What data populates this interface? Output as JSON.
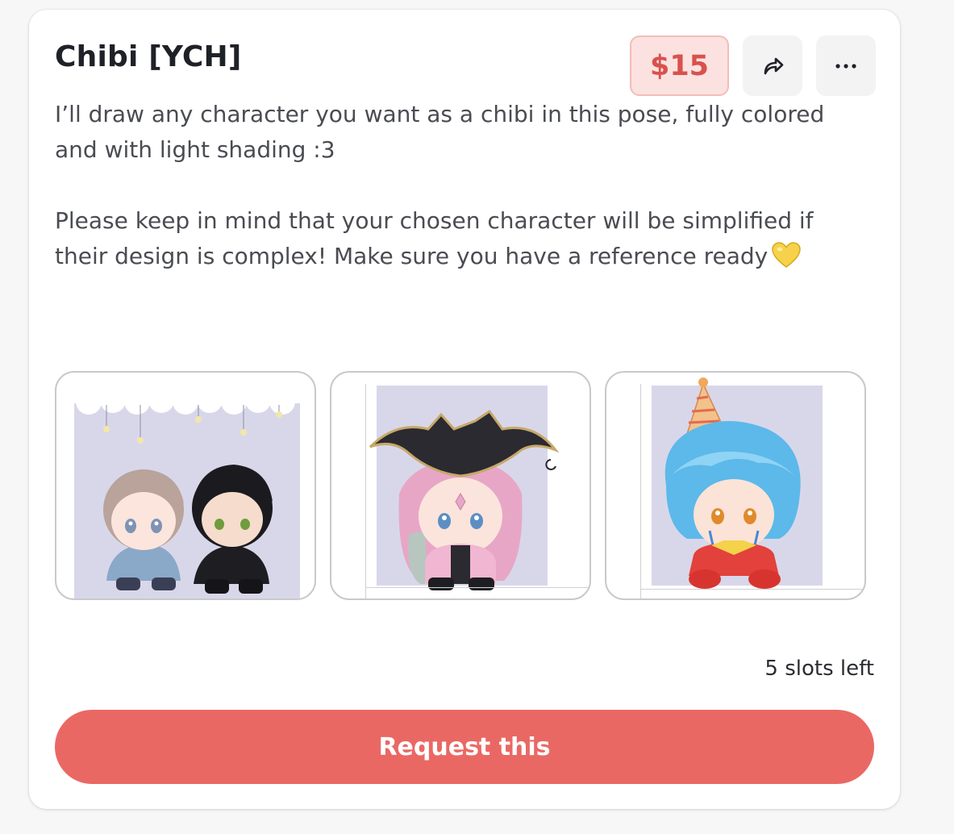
{
  "listing": {
    "title": "Chibi [YCH]",
    "price": "$15",
    "description_line1": "I’ll draw any character you want as a chibi in this pose, fully colored and with light shading :3",
    "description_line2": "Please keep in mind that your chosen character will be simplified if their design is complex! Make sure you have a reference ready",
    "slots_left": "5 slots left",
    "request_label": "Request this"
  },
  "icons": {
    "share": "share-arrow-icon",
    "more": "more-dots-icon",
    "heart": "yellow-heart-emoji"
  },
  "gallery": {
    "images": [
      {
        "name": "two-chibi-boys-under-clouds"
      },
      {
        "name": "pink-haired-pirate-chibi"
      },
      {
        "name": "blue-haired-clown-chibi"
      }
    ]
  },
  "colors": {
    "accent": "#ea6864",
    "price_bg": "#fbe2e0",
    "price_text": "#d9514d",
    "image_bg": "#d8d7ea"
  }
}
